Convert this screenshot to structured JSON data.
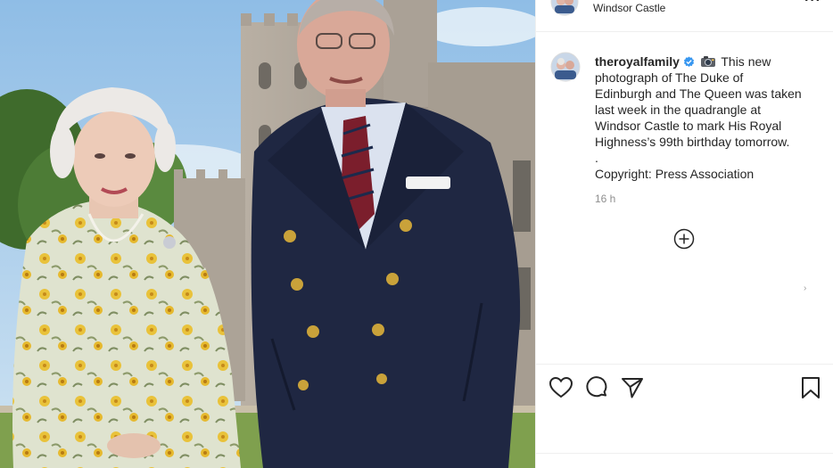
{
  "post": {
    "location": "Windsor Castle",
    "more_label": "···",
    "author": "theroyalfamily",
    "caption_lines": [
      "This new",
      "photograph of The Duke of",
      "Edinburgh and The Queen was taken",
      "last week in the quadrangle at",
      "Windsor Castle to mark His Royal",
      "Highness’s 99th birthday tomorrow.",
      ".",
      "Copyright: Press Association"
    ],
    "timestamp": "16 h",
    "edge_glyph": "›"
  },
  "photo": {
    "alt": "The Duke of Edinburgh and The Queen at Windsor Castle"
  },
  "icons": {
    "verified": "verified-badge-icon",
    "camera": "camera-emoji-icon",
    "load_more": "plus-circle-icon",
    "like": "heart-icon",
    "comment": "comment-icon",
    "share": "paper-plane-icon",
    "save": "bookmark-icon"
  },
  "colors": {
    "verified": "#3897f0",
    "text": "#262626",
    "muted": "#8e8e8e",
    "divider": "#efefef"
  }
}
